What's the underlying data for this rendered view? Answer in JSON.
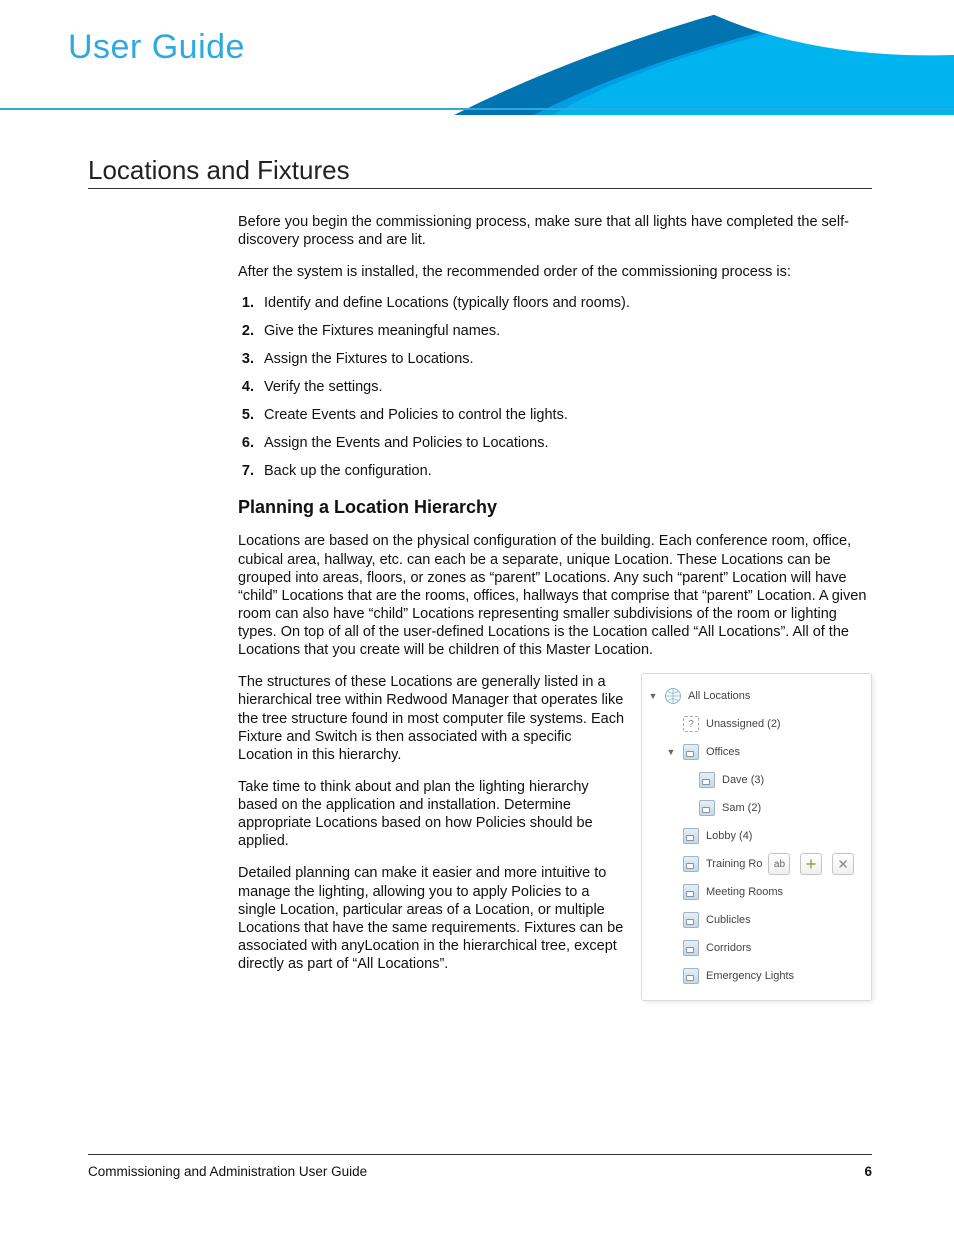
{
  "header": {
    "title": "User Guide"
  },
  "section": {
    "title": "Locations and Fixtures",
    "intro1": "Before you begin the commissioning process, make sure that all lights have completed the self- discovery process and are lit.",
    "intro2": "After the system is installed, the recommended order of the commissioning process is:",
    "steps": [
      "Identify and define Locations (typically floors and rooms).",
      "Give the Fixtures meaningful names.",
      "Assign the Fixtures to Locations.",
      "Verify the settings.",
      "Create Events and Policies to control the lights.",
      "Assign the Events and Policies to Locations.",
      "Back up the configuration."
    ],
    "subhead": "Planning a Location Hierarchy",
    "p1": "Locations are based on the physical configuration of the building. Each conference room, office, cubical area, hallway, etc. can each be a separate, unique Location. These Locations can be grouped into areas, floors, or zones as “parent” Locations. Any such “parent” Location will have “child” Locations that are the rooms, offices, hallways that comprise that “parent” Location. A given room can also have “child” Locations representing smaller subdivisions of the room or lighting types. On top of all of the user-defined Locations is the Location called “All Locations”. All of the Locations that you create will be children of this Master Location.",
    "p2": "The structures of these Locations are generally listed in a hierarchical tree within Redwood Manager that operates like the tree structure found in most computer file systems. Each Fixture and Switch is then associated with a specific Location in this hierarchy.",
    "p3": "Take time to think about and plan the lighting hierarchy based on the application and installation. Determine appropriate Locations based on how Policies should be applied.",
    "p4": "Detailed planning can make it easier and more intuitive to manage the lighting, allowing you to apply Policies to a single Location, particular areas of a Location, or multiple Locations that have the same requirements. Fixtures can be associated with anyLocation in the hierarchical tree, except directly as part of “All Locations”."
  },
  "tree": {
    "root": "All Locations",
    "unassigned": "Unassigned  (2)",
    "offices": "Offices",
    "dave": "Dave  (3)",
    "sam": "Sam  (2)",
    "lobby": "Lobby  (4)",
    "training": "Training Ro",
    "rename_btn": "ab",
    "meeting": "Meeting Rooms",
    "cubicles": "Cublicles",
    "corridors": "Corridors",
    "emergency": "Emergency Lights"
  },
  "footer": {
    "left": "Commissioning and Administration User Guide",
    "page": "6"
  }
}
